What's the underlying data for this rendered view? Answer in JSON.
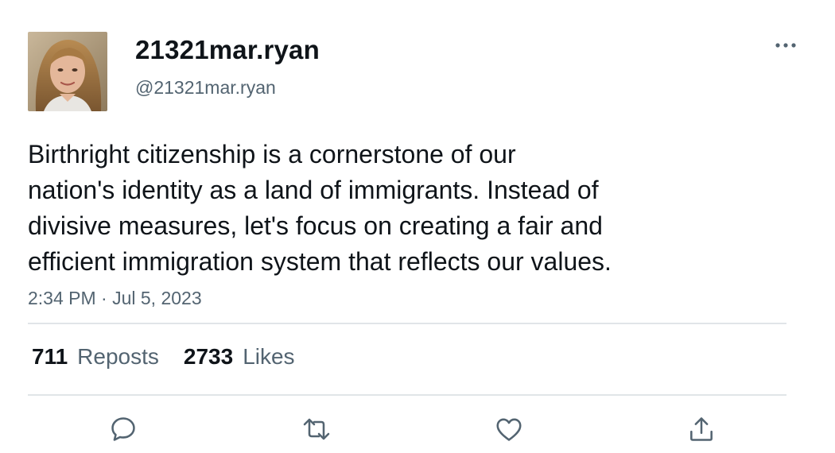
{
  "user": {
    "display_name": "21321mar.ryan",
    "handle": "@21321mar.ryan",
    "avatar_icon": "profile-photo"
  },
  "tweet": {
    "lines": [
      "Birthright citizenship is a cornerstone of our",
      "nation's identity as a land of immigrants. Instead of",
      "divisive measures, let's focus on creating a fair and",
      "efficient immigration system that reflects our values."
    ],
    "timestamp": "2:34 PM · Jul 5, 2023"
  },
  "stats": {
    "reposts_count": "711",
    "reposts_label": "Reposts",
    "likes_count": "2733",
    "likes_label": "Likes"
  },
  "actions": {
    "reply_icon": "reply-icon",
    "repost_icon": "repost-icon",
    "like_icon": "heart-icon",
    "share_icon": "share-icon",
    "more_icon": "more-icon"
  },
  "colors": {
    "text_primary": "#0f1419",
    "text_secondary": "#536471",
    "divider": "#e1e5e8",
    "icon": "#536471"
  }
}
